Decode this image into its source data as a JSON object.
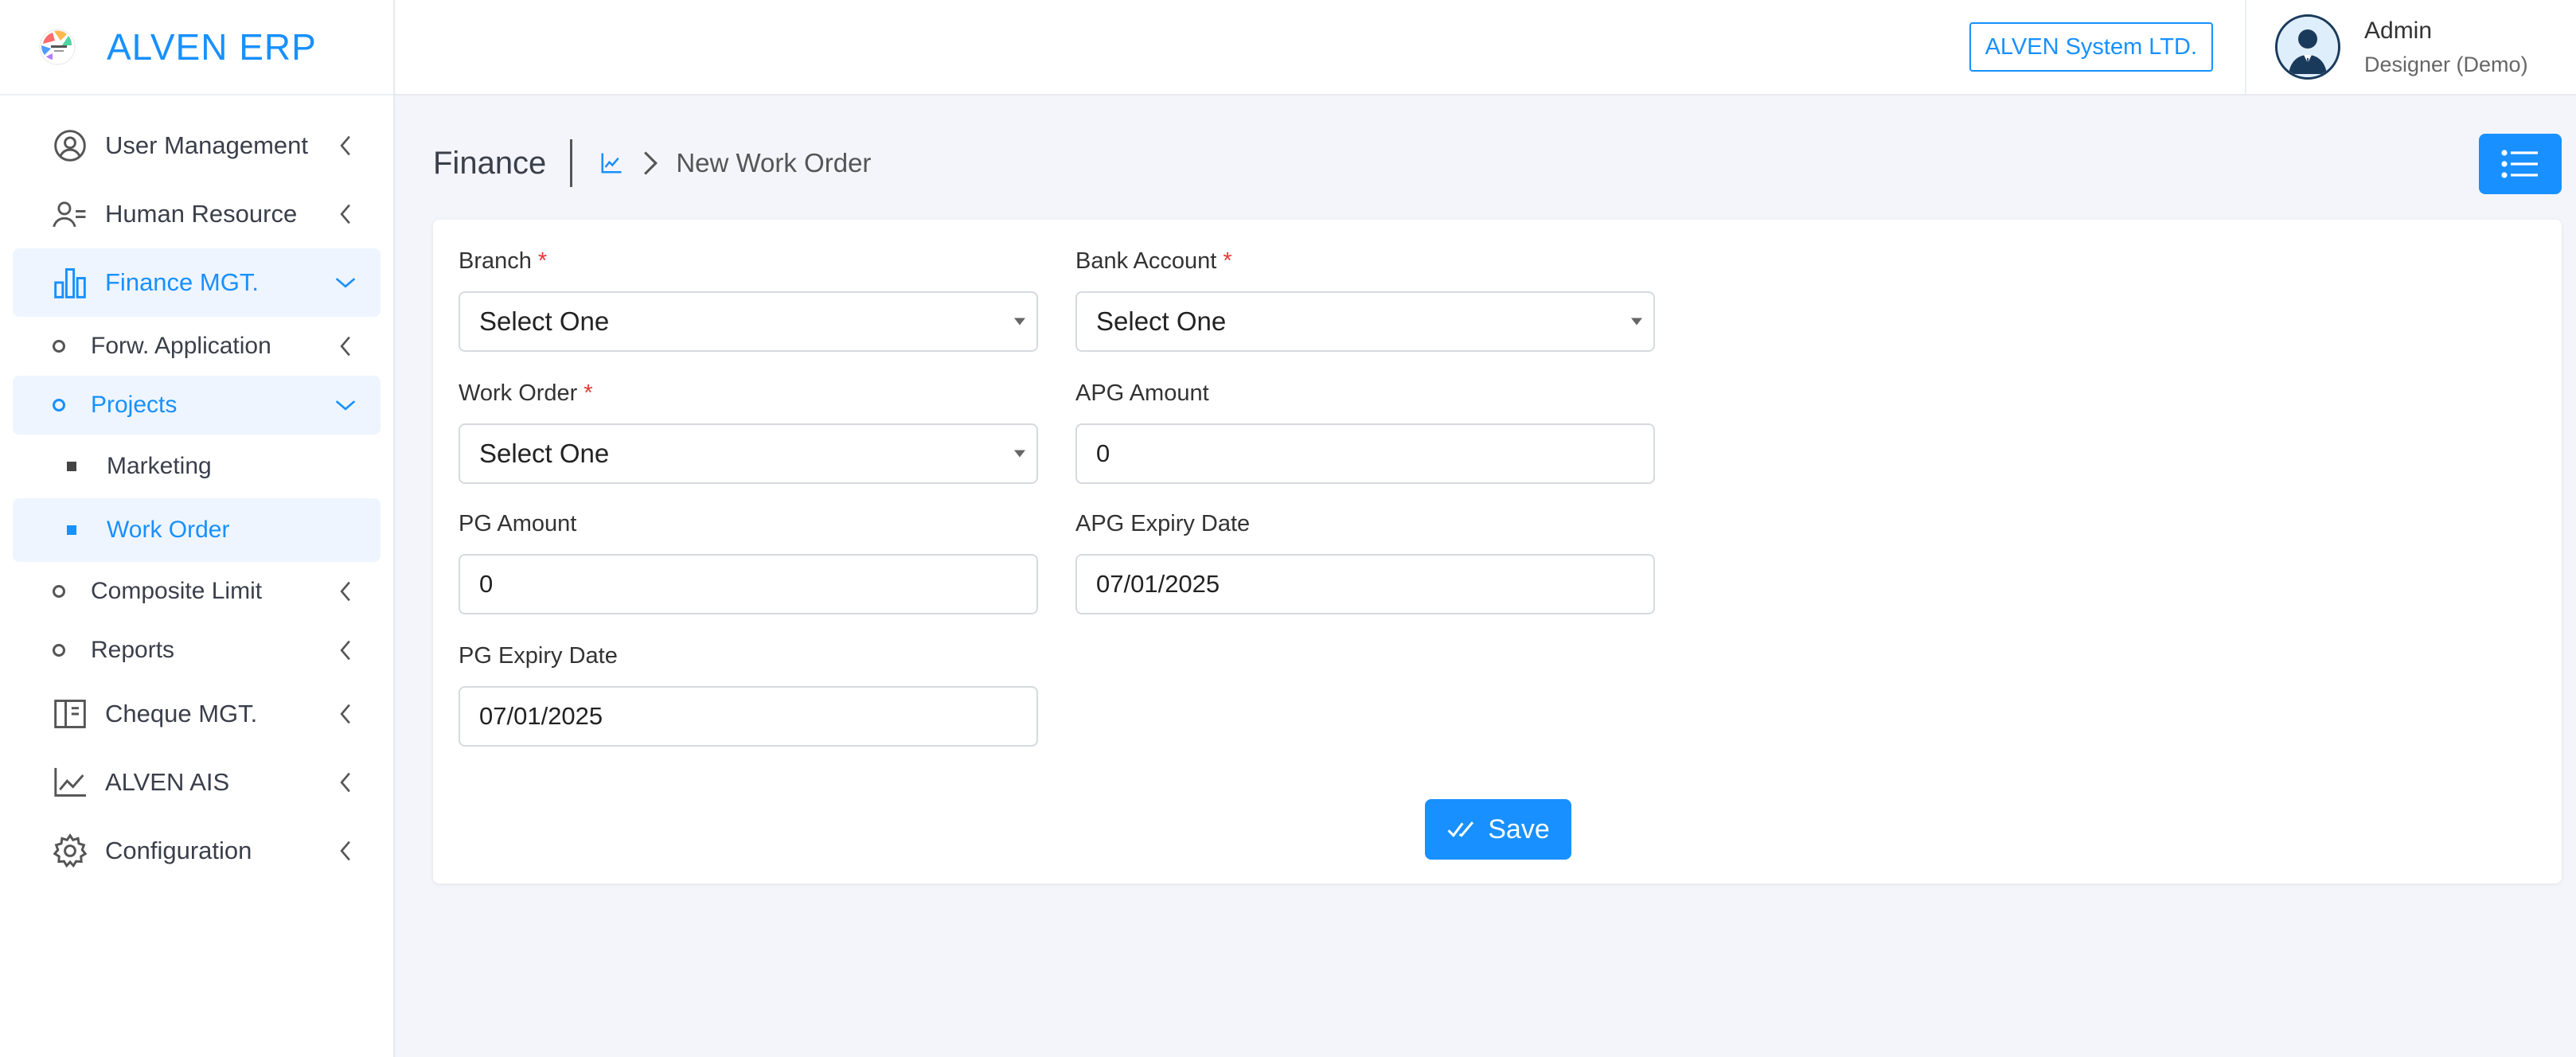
{
  "brand": {
    "name": "ALVEN ERP"
  },
  "header": {
    "company": "ALVEN System LTD.",
    "user_name": "Admin",
    "user_role": "Designer (Demo)"
  },
  "sidebar": {
    "items": [
      {
        "label": "User Management",
        "icon": "user-circle-icon"
      },
      {
        "label": "Human Resource",
        "icon": "users-icon"
      },
      {
        "label": "Finance MGT.",
        "icon": "bar-chart-icon",
        "active": true
      },
      {
        "label": "Forw. Application"
      },
      {
        "label": "Projects",
        "active": true
      },
      {
        "label": "Marketing"
      },
      {
        "label": "Work Order",
        "active": true
      },
      {
        "label": "Composite Limit"
      },
      {
        "label": "Reports"
      },
      {
        "label": "Cheque MGT.",
        "icon": "book-icon"
      },
      {
        "label": "ALVEN AIS",
        "icon": "line-chart-icon"
      },
      {
        "label": "Configuration",
        "icon": "gear-icon"
      }
    ]
  },
  "page": {
    "title": "Finance",
    "breadcrumb": "New Work Order"
  },
  "form": {
    "branch": {
      "label": "Branch",
      "value": "Select One"
    },
    "bank_account": {
      "label": "Bank Account",
      "value": "Select One"
    },
    "work_order": {
      "label": "Work Order",
      "value": "Select One"
    },
    "apg_amount": {
      "label": "APG Amount",
      "value": "0"
    },
    "pg_amount": {
      "label": "PG Amount",
      "value": "0"
    },
    "apg_expiry_date": {
      "label": "APG Expiry Date",
      "value": "07/01/2025"
    },
    "pg_expiry_date": {
      "label": "PG Expiry Date",
      "value": "07/01/2025"
    },
    "required_mark": "*",
    "save_label": "Save"
  },
  "colors": {
    "accent": "#1890ff",
    "required": "#e53935",
    "background": "#f4f5fb"
  }
}
